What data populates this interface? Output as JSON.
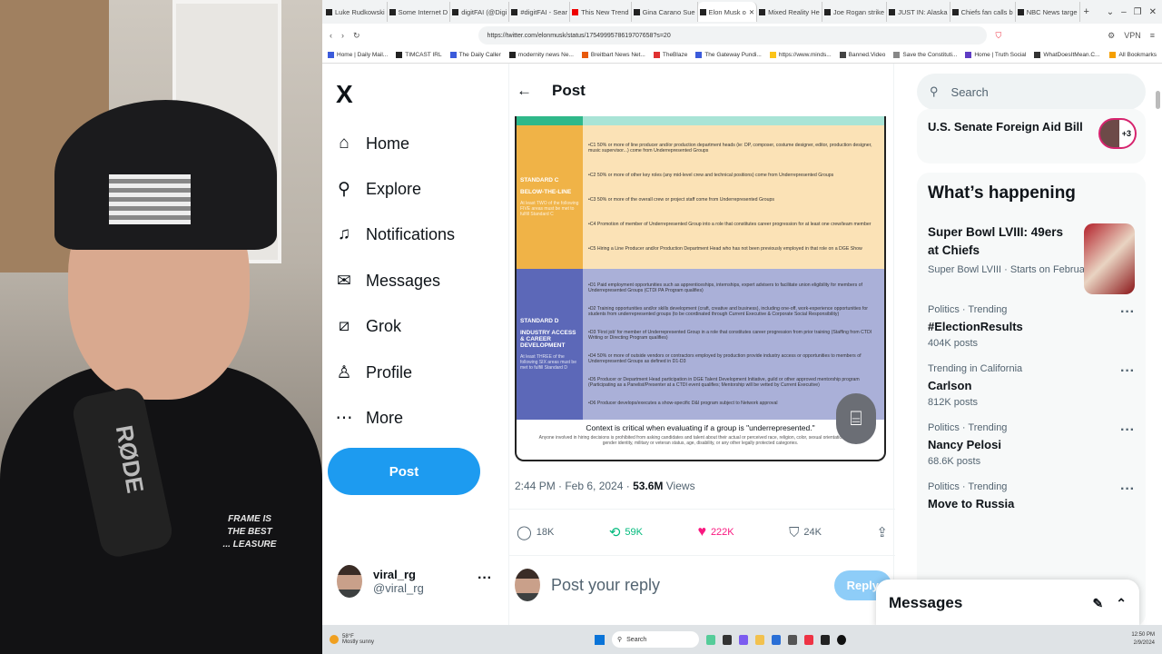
{
  "webcam": {
    "mic_label": "RØDE",
    "shirt_text": "FRAME IS THE BEST ... LEASURE"
  },
  "browser": {
    "tabs": [
      {
        "label": "Luke Rudkowski"
      },
      {
        "label": "Some Internet D"
      },
      {
        "label": "digitFAI (@Digi"
      },
      {
        "label": "#digitFAI - Sear"
      },
      {
        "label": "This New Trend"
      },
      {
        "label": "Gina Carano Sue"
      },
      {
        "label": "Elon Musk o",
        "active": true
      },
      {
        "label": "Mixed Reality He"
      },
      {
        "label": "Joe Rogan strike"
      },
      {
        "label": "JUST IN: Alaska"
      },
      {
        "label": "Chiefs fan calls b"
      },
      {
        "label": "NBC News targe"
      }
    ],
    "new_tab": "+",
    "url": "https://twitter.com/elonmusk/status/1754999578619707658?s=20",
    "vpn": "VPN",
    "bookmarks": [
      "Home | Daily Mail...",
      "TIMCAST IRL",
      "The Daily Caller",
      "modernity news Ne...",
      "Breitbart News Net...",
      "TheBlaze",
      "The Gateway Pundi...",
      "https://www.minds...",
      "Banned.Video",
      "Save the Constituti...",
      "Home | Truth Social",
      "WhatDoesItMean.C..."
    ],
    "all_bookmarks": "All Bookmarks"
  },
  "nav": {
    "logo": "X",
    "items": [
      {
        "label": "Home",
        "icon": "home-icon"
      },
      {
        "label": "Explore",
        "icon": "search-icon"
      },
      {
        "label": "Notifications",
        "icon": "bell-icon"
      },
      {
        "label": "Messages",
        "icon": "mail-icon"
      },
      {
        "label": "Grok",
        "icon": "grok-icon"
      },
      {
        "label": "Profile",
        "icon": "person-icon"
      },
      {
        "label": "More",
        "icon": "more-icon"
      }
    ],
    "post": "Post",
    "user": {
      "name": "viral_rg",
      "handle": "@viral_rg"
    }
  },
  "post": {
    "header": "Post",
    "image": {
      "standard_c": {
        "title": "STANDARD C",
        "subtitle": "BELOW-THE-LINE",
        "note": "At least TWO of the following FIVE areas must be met to fulfill Standard C",
        "items": [
          "•C1 50% or more of line producer and/or production department heads (ie: DP, composer, costume designer, editor, production designer, music supervisor...) come from Underrepresented Groups",
          "•C2 50% or more of other key roles (any mid-level crew and technical positions) come from Underrepresented Groups",
          "•C3 50% or more of the overall crew or project staff come from Underrepresented Groups",
          "•C4 Promotion of member of Underrepresented Group into a role that constitutes career progression for at least one crew/team member",
          "•C5 Hiring a Line Producer and/or Production Department Head who has not been previously employed in that role on a DGE Show"
        ]
      },
      "standard_d": {
        "title": "STANDARD D",
        "subtitle": "INDUSTRY ACCESS & CAREER DEVELOPMENT",
        "note": "At least THREE of the following SIX areas must be met to fulfill Standard D",
        "items": [
          "•D1 Paid employment opportunities such as apprenticeships, internships, expert advisers to facilitate union eligibility for members of Underrepresented Groups (CTDI PA Program qualifies)",
          "•D2 Training opportunities and/or skills development (craft, creative and business), including one-off, work-experience opportunities for students from underrepresented groups (to be coordinated through Current Executive & Corporate Social Responsibility)",
          "•D3 'First job' for member of Underrepresented Group in a role that constitutes career progression from prior training (Staffing from CTDI Writing or Directing Program qualifies)",
          "•D4 50% or more of outside vendors or contractors employed by production provide industry access or opportunities to members of Underrepresented Groups as defined in D1-D3",
          "•D5 Producer or Department Head participation in DGE Talent Development Initiative, guild or other approved mentorship program (Participating as a Panelist/Presenter at a CTDI event qualifies; Mentorship will be vetted by Current Executive)",
          "•D6 Producer develops/executes a show-specific D&I program subject to Network approval"
        ]
      },
      "context": "Context is critical when evaluating if a group is \"underrepresented.\"",
      "disclaimer": "Anyone involved in hiring decisions is prohibited from asking candidates and talent about their actual or perceived race, religion, color, sexual orientation, gender, gender identity, military or veteran status, age, disability, or any other legally protected categories."
    },
    "time": "2:44 PM · Feb 6, 2024 · ",
    "views": "53.6M",
    "views_label": " Views",
    "replies": "18K",
    "reposts": "59K",
    "likes": "222K",
    "bookmarks": "24K",
    "reply_placeholder": "Post your reply",
    "reply_button": "Reply"
  },
  "sidebar": {
    "search_placeholder": "Search",
    "spaces": {
      "title": "U.S. Senate Foreign Aid Bill",
      "count": "+3"
    },
    "happening_title": "What’s happening",
    "featured": {
      "title": "Super Bowl LVIII: 49ers at Chiefs",
      "meta": "Super Bowl LVIII · Starts on February"
    },
    "trends": [
      {
        "context": "Politics · Trending",
        "title": "#ElectionResults",
        "count": "404K posts"
      },
      {
        "context": "Trending in California",
        "title": "Carlson",
        "count": "812K posts"
      },
      {
        "context": "Politics · Trending",
        "title": "Nancy Pelosi",
        "count": "68.6K posts"
      },
      {
        "context": "Politics · Trending",
        "title": "Move to Russia",
        "count": ""
      }
    ]
  },
  "messages_drawer": "Messages",
  "taskbar": {
    "temp": "58°F",
    "weather": "Mostly sunny",
    "search": "Search",
    "time": "12:50 PM",
    "date": "2/9/2024"
  },
  "colors": {
    "accent": "#1d9bf0",
    "like": "#f91880",
    "repost": "#00ba7c"
  }
}
